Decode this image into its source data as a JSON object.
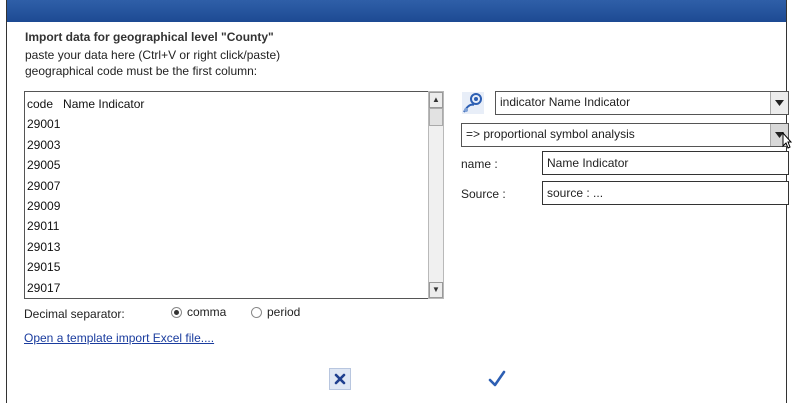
{
  "dialog": {
    "title": "Import data for geographical level \"County\"",
    "hint_paste": "paste your data here (Ctrl+V or right click/paste)",
    "hint_code": "geographical code must be the first column:"
  },
  "data_area": {
    "lines": [
      "code   Name Indicator",
      "29001",
      "29003",
      "29005",
      "29007",
      "29009",
      "29011",
      "29013",
      "29015",
      "29017"
    ]
  },
  "decimal": {
    "label": "Decimal separator:",
    "options": [
      {
        "label": "comma",
        "selected": true
      },
      {
        "label": "period",
        "selected": false
      }
    ]
  },
  "template_link": "Open a template import Excel file....",
  "indicator": {
    "icon": "indicator-settings-icon",
    "selected": "indicator Name Indicator"
  },
  "analysis": {
    "selected": "=> proportional symbol analysis"
  },
  "fields": {
    "name_label": "name :",
    "name_value": "Name Indicator",
    "source_label": "Source :",
    "source_value": "source : ..."
  },
  "colors": {
    "topbar": "#1d4a93",
    "link": "#1a3c9e",
    "cancel_icon": "#1f3f8f",
    "ok_icon": "#2d5fb3"
  },
  "actions": {
    "cancel_icon": "close-icon",
    "ok_icon": "checkmark-icon"
  }
}
